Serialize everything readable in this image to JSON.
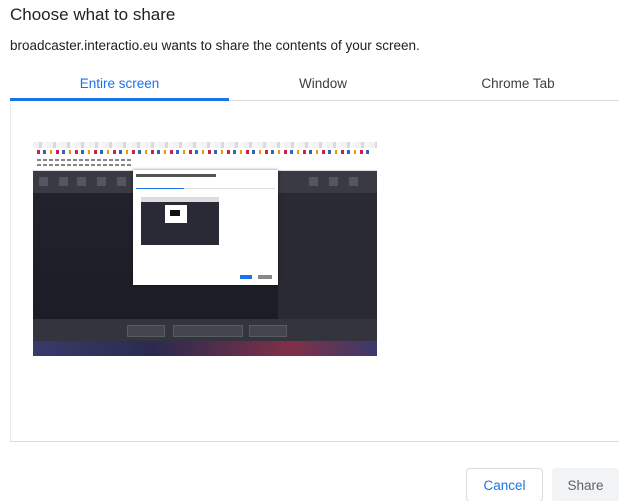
{
  "dialog": {
    "title": "Choose what to share",
    "subtitle": "broadcaster.interactio.eu wants to share the contents of your screen."
  },
  "tabs": [
    {
      "label": "Entire screen",
      "active": true
    },
    {
      "label": "Window",
      "active": false
    },
    {
      "label": "Chrome Tab",
      "active": false
    }
  ],
  "buttons": {
    "cancel": "Cancel",
    "share": "Share"
  },
  "colors": {
    "accent": "#1a73e8",
    "divider": "#dadce0"
  }
}
